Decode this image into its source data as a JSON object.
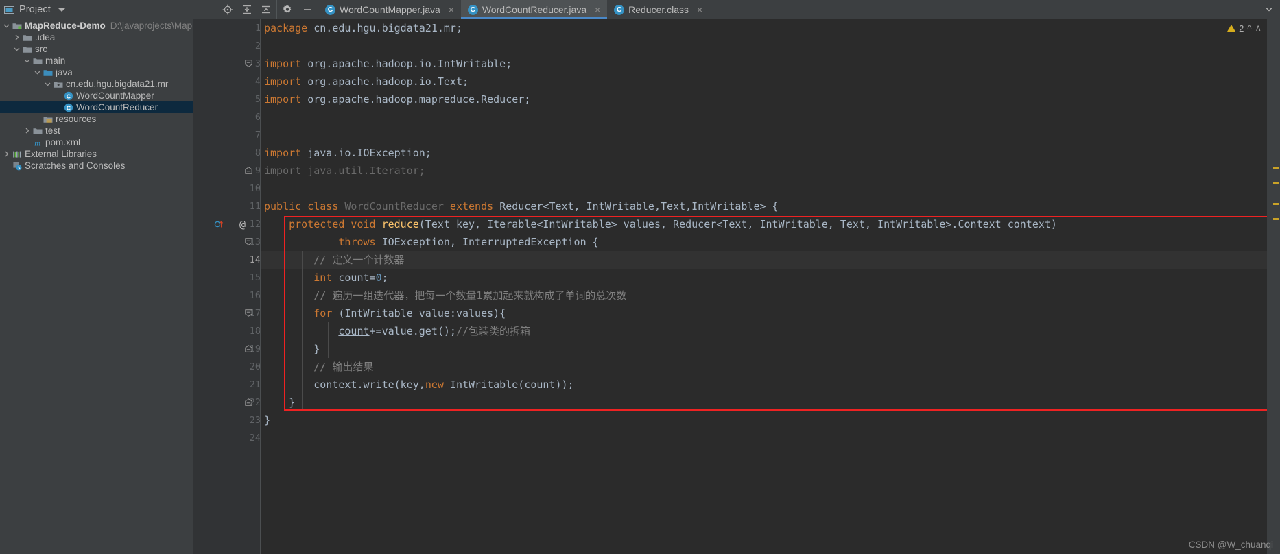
{
  "window": {
    "app": "IntelliJ IDEA",
    "theme_bg": "#3c3f41",
    "editor_bg": "#2b2b2b",
    "accent": "#4a88c7",
    "annotation_color": "#ee2222"
  },
  "toolwindow": {
    "title": "Project",
    "title_caret": "caret-down-icon",
    "actions": [
      {
        "name": "locate-icon",
        "tooltip": "Select Opened File"
      },
      {
        "name": "expand-all-icon",
        "tooltip": "Expand All"
      },
      {
        "name": "collapse-all-icon",
        "tooltip": "Collapse All"
      },
      {
        "name": "gear-icon",
        "tooltip": "Settings"
      },
      {
        "name": "minimize-icon",
        "tooltip": "Hide"
      }
    ]
  },
  "tree": {
    "items": [
      {
        "label": "MapReduce-Demo",
        "sub": "D:\\javaprojects\\MapReduce-De",
        "icon": "project-module-icon",
        "arrow": "chevron-down",
        "indent": 0,
        "bold": true,
        "selected": false
      },
      {
        "label": ".idea",
        "sub": "",
        "icon": "folder-icon",
        "arrow": "chevron-right",
        "indent": 1,
        "bold": false,
        "selected": false
      },
      {
        "label": "src",
        "sub": "",
        "icon": "folder-icon",
        "arrow": "chevron-down",
        "indent": 1,
        "bold": false,
        "selected": false
      },
      {
        "label": "main",
        "sub": "",
        "icon": "folder-icon",
        "arrow": "chevron-down",
        "indent": 2,
        "bold": false,
        "selected": false
      },
      {
        "label": "java",
        "sub": "",
        "icon": "source-folder-icon",
        "arrow": "chevron-down",
        "indent": 3,
        "bold": false,
        "selected": false
      },
      {
        "label": "cn.edu.hgu.bigdata21.mr",
        "sub": "",
        "icon": "package-icon",
        "arrow": "chevron-down",
        "indent": 4,
        "bold": false,
        "selected": false
      },
      {
        "label": "WordCountMapper",
        "sub": "",
        "icon": "java-class-icon",
        "arrow": "none",
        "indent": 5,
        "bold": false,
        "selected": false
      },
      {
        "label": "WordCountReducer",
        "sub": "",
        "icon": "java-class-icon",
        "arrow": "none",
        "indent": 5,
        "bold": false,
        "selected": true
      },
      {
        "label": "resources",
        "sub": "",
        "icon": "resources-folder-icon",
        "arrow": "none",
        "indent": 3,
        "bold": false,
        "selected": false
      },
      {
        "label": "test",
        "sub": "",
        "icon": "folder-icon",
        "arrow": "chevron-right",
        "indent": 2,
        "bold": false,
        "selected": false
      },
      {
        "label": "pom.xml",
        "sub": "",
        "icon": "maven-icon",
        "arrow": "none",
        "indent": 2,
        "bold": false,
        "selected": false
      },
      {
        "label": "External Libraries",
        "sub": "",
        "icon": "libraries-icon",
        "arrow": "chevron-right",
        "indent": 0,
        "bold": false,
        "selected": false
      },
      {
        "label": "Scratches and Consoles",
        "sub": "",
        "icon": "scratches-icon",
        "arrow": "none",
        "indent": 0,
        "bold": false,
        "selected": false
      }
    ]
  },
  "tabs": {
    "items": [
      {
        "label": "WordCountMapper.java",
        "icon": "java-class-icon",
        "active": false,
        "close": "×"
      },
      {
        "label": "WordCountReducer.java",
        "icon": "java-class-icon",
        "active": true,
        "close": "×"
      },
      {
        "label": "Reducer.class",
        "icon": "java-class-icon",
        "active": false,
        "close": "×"
      }
    ]
  },
  "inspection": {
    "warning_count": "2",
    "warning_icon": "warning-triangle-icon",
    "chevron": "⌃"
  },
  "editor": {
    "file": "WordCountReducer.java",
    "current_line": 14,
    "first_line": 1,
    "last_line": 24,
    "lines": [
      {
        "n": 1,
        "tokens": [
          {
            "t": "package",
            "c": "kw"
          },
          {
            "t": " cn.edu.hgu.bigdata21.mr;",
            "c": "id"
          }
        ]
      },
      {
        "n": 2,
        "tokens": []
      },
      {
        "n": 3,
        "tokens": [
          {
            "t": "import",
            "c": "kw"
          },
          {
            "t": " org.apache.hadoop.io.IntWritable;",
            "c": "id"
          }
        ],
        "fold": "start"
      },
      {
        "n": 4,
        "tokens": [
          {
            "t": "import",
            "c": "kw"
          },
          {
            "t": " org.apache.hadoop.io.Text;",
            "c": "id"
          }
        ]
      },
      {
        "n": 5,
        "tokens": [
          {
            "t": "import",
            "c": "kw"
          },
          {
            "t": " org.apache.hadoop.mapreduce.Reducer;",
            "c": "id"
          }
        ]
      },
      {
        "n": 6,
        "tokens": []
      },
      {
        "n": 7,
        "tokens": []
      },
      {
        "n": 8,
        "tokens": [
          {
            "t": "import",
            "c": "kw"
          },
          {
            "t": " java.io.IOException;",
            "c": "id"
          }
        ]
      },
      {
        "n": 9,
        "tokens": [
          {
            "t": "import java.util.Iterator;",
            "c": "gry"
          }
        ],
        "fold": "end"
      },
      {
        "n": 10,
        "tokens": []
      },
      {
        "n": 11,
        "tokens": [
          {
            "t": "public class ",
            "c": "kw"
          },
          {
            "t": "WordCountReducer",
            "c": "gry"
          },
          {
            "t": " extends ",
            "c": "kw"
          },
          {
            "t": "Reducer<Text, IntWritable,Text,IntWritable> {",
            "c": "id"
          }
        ]
      },
      {
        "n": 12,
        "tokens": [
          {
            "t": "    ",
            "c": "id"
          },
          {
            "t": "protected void ",
            "c": "kw"
          },
          {
            "t": "reduce",
            "c": "mth"
          },
          {
            "t": "(Text key, Iterable<IntWritable> values, Reducer<Text, IntWritable, Text, IntWritable>.Context context)",
            "c": "id"
          }
        ],
        "gutter": {
          "override": "override-icon",
          "at": "@"
        }
      },
      {
        "n": 13,
        "tokens": [
          {
            "t": "            ",
            "c": "id"
          },
          {
            "t": "throws ",
            "c": "kw"
          },
          {
            "t": "IOException, InterruptedException {",
            "c": "id"
          }
        ],
        "fold": "start"
      },
      {
        "n": 14,
        "tokens": [
          {
            "t": "        ",
            "c": "id"
          },
          {
            "t": "// 定义一个计数器",
            "c": "cmt"
          }
        ]
      },
      {
        "n": 15,
        "tokens": [
          {
            "t": "        ",
            "c": "id"
          },
          {
            "t": "int ",
            "c": "kw"
          },
          {
            "t": "count",
            "c": "fld"
          },
          {
            "t": "=",
            "c": "id"
          },
          {
            "t": "0",
            "c": "num"
          },
          {
            "t": ";",
            "c": "id"
          }
        ]
      },
      {
        "n": 16,
        "tokens": [
          {
            "t": "        ",
            "c": "id"
          },
          {
            "t": "// 遍历一组迭代器，把每一个数量1累加起来就构成了单词的总次数",
            "c": "cmt"
          }
        ]
      },
      {
        "n": 17,
        "tokens": [
          {
            "t": "        ",
            "c": "id"
          },
          {
            "t": "for ",
            "c": "kw"
          },
          {
            "t": "(IntWritable value:values){",
            "c": "id"
          }
        ],
        "fold": "start"
      },
      {
        "n": 18,
        "tokens": [
          {
            "t": "            ",
            "c": "id"
          },
          {
            "t": "count",
            "c": "fld"
          },
          {
            "t": "+=value.get();",
            "c": "id"
          },
          {
            "t": "//包装类的拆箱",
            "c": "cmt"
          }
        ]
      },
      {
        "n": 19,
        "tokens": [
          {
            "t": "        }",
            "c": "id"
          }
        ],
        "fold": "end"
      },
      {
        "n": 20,
        "tokens": [
          {
            "t": "        ",
            "c": "id"
          },
          {
            "t": "// 输出结果",
            "c": "cmt"
          }
        ]
      },
      {
        "n": 21,
        "tokens": [
          {
            "t": "        context.write(key,",
            "c": "id"
          },
          {
            "t": "new ",
            "c": "kw"
          },
          {
            "t": "IntWritable(",
            "c": "id"
          },
          {
            "t": "count",
            "c": "fld"
          },
          {
            "t": "));",
            "c": "id"
          }
        ]
      },
      {
        "n": 22,
        "tokens": [
          {
            "t": "    }",
            "c": "id"
          }
        ],
        "fold": "end"
      },
      {
        "n": 23,
        "tokens": [
          {
            "t": "}",
            "c": "id"
          }
        ]
      },
      {
        "n": 24,
        "tokens": []
      }
    ]
  },
  "watermark": "CSDN @W_chuanqi"
}
